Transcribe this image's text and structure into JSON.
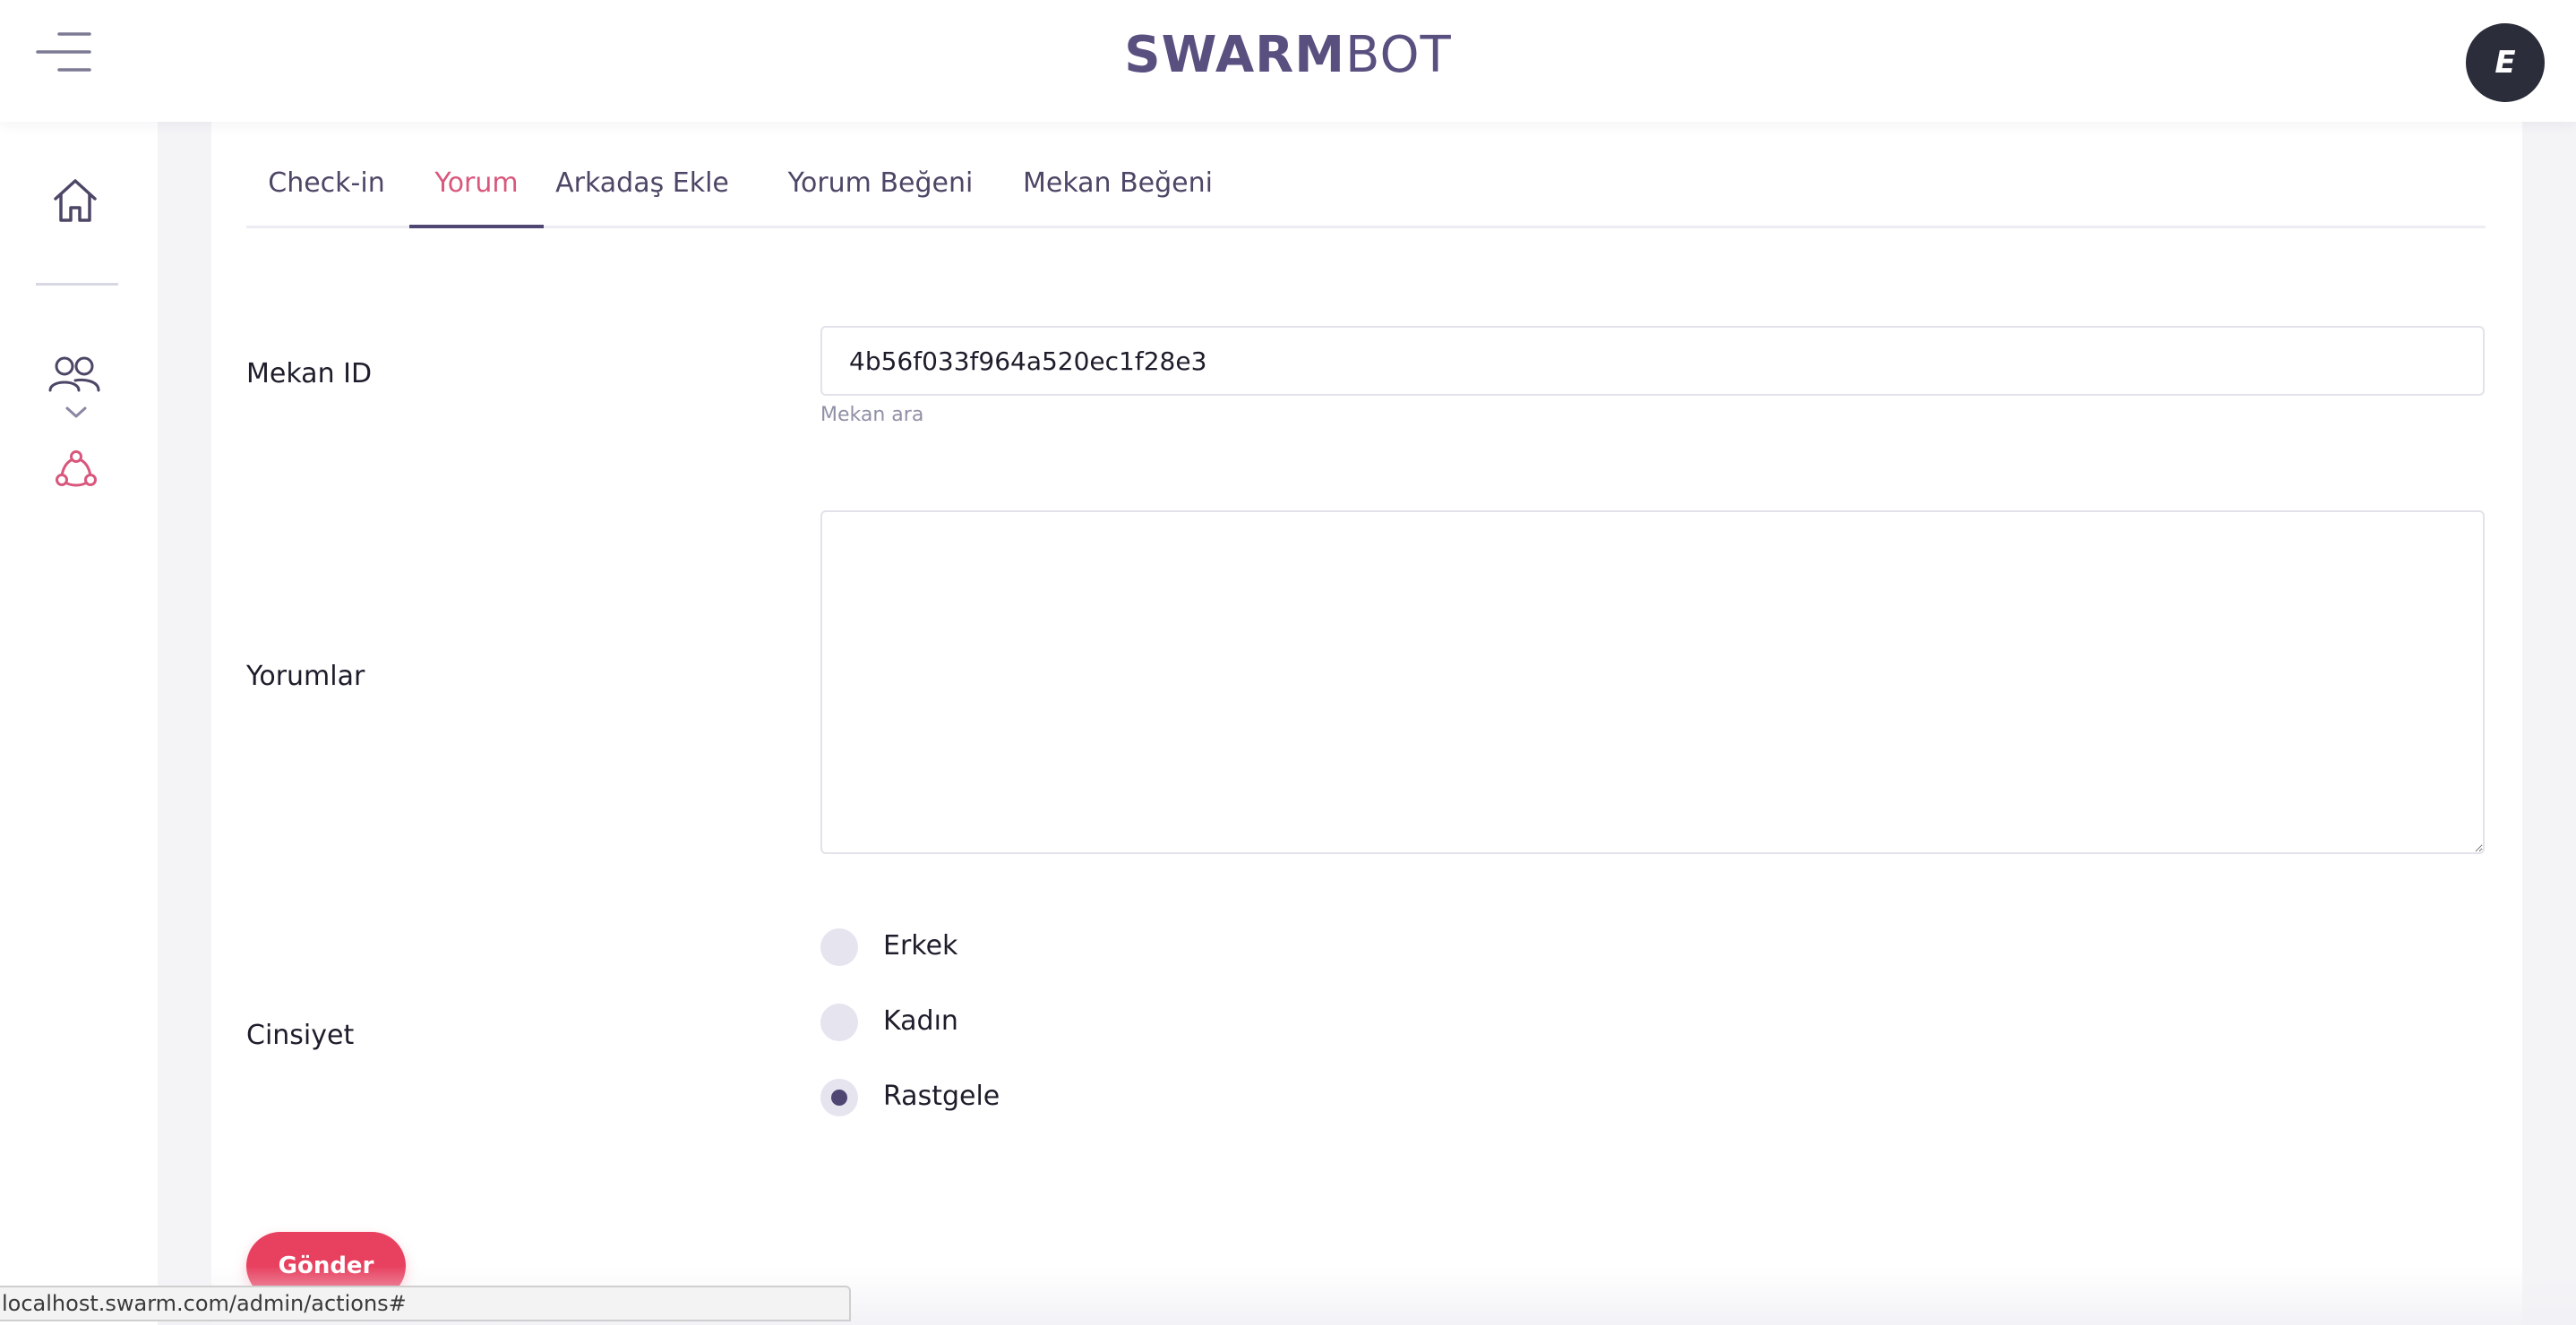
{
  "header": {
    "brand_bold": "SWARM",
    "brand_light": "BOT",
    "avatar_initial": "E",
    "menu_icon": "hamburger-menu-icon"
  },
  "sidebar": {
    "items": [
      {
        "icon": "home-icon"
      },
      {
        "icon": "users-icon",
        "expand_icon": "chevron-down-icon"
      },
      {
        "icon": "network-icon",
        "active": true
      }
    ]
  },
  "tabs": [
    {
      "label": "Check-in",
      "active": false
    },
    {
      "label": "Yorum",
      "active": true
    },
    {
      "label": "Arkadaş Ekle",
      "active": false
    },
    {
      "label": "Yorum Beğeni",
      "active": false
    },
    {
      "label": "Mekan Beğeni",
      "active": false
    }
  ],
  "form": {
    "venue_id": {
      "label": "Mekan ID",
      "value": "4b56f033f964a520ec1f28e3",
      "hint": "Mekan ara"
    },
    "comments": {
      "label": "Yorumlar",
      "value": ""
    },
    "gender": {
      "label": "Cinsiyet",
      "options": [
        {
          "label": "Erkek",
          "checked": false
        },
        {
          "label": "Kadın",
          "checked": false
        },
        {
          "label": "Rastgele",
          "checked": true
        }
      ]
    },
    "submit_label": "Gönder"
  },
  "status_bar": {
    "url": "localhost.swarm.com/admin/actions#"
  },
  "colors": {
    "brand": "#5a5080",
    "accent_pink": "#d9577c",
    "button_red": "#e8405f",
    "tab_underline": "#4f4673",
    "avatar_bg": "#2b2d3a"
  }
}
